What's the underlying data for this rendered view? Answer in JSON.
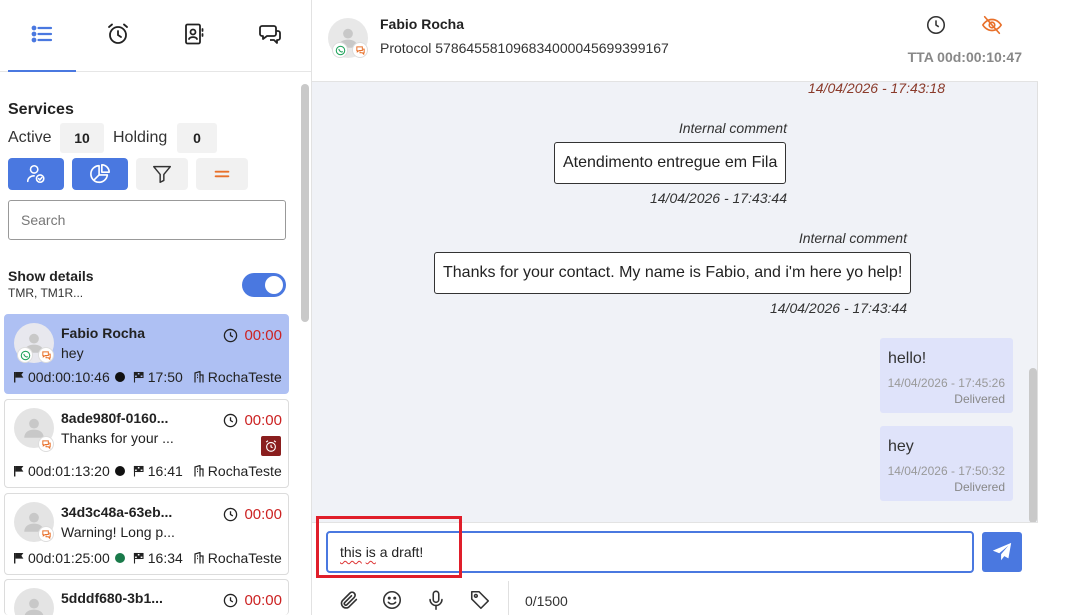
{
  "sidebar": {
    "tabs": [
      {
        "name": "list",
        "icon": "list-icon"
      },
      {
        "name": "alarm",
        "icon": "alarm-clock-icon"
      },
      {
        "name": "contacts",
        "icon": "contact-book-icon"
      },
      {
        "name": "chats",
        "icon": "chat-bubbles-icon"
      }
    ],
    "services_title": "Services",
    "active_label": "Active",
    "active_count": "10",
    "holding_label": "Holding",
    "holding_count": "0",
    "search_placeholder": "Search",
    "show_details_label": "Show details",
    "details_sub": "TMR, TM1R...",
    "show_details_on": true,
    "cards": [
      {
        "name": "Fabio Rocha",
        "message": "hey",
        "time": "00:00",
        "duration": "00d:00:10:46",
        "status_color": "#111111",
        "flag_time": "17:50",
        "team": "RochaTeste",
        "active": true
      },
      {
        "name": "8ade980f-0160...",
        "message": "Thanks for your ...",
        "time": "00:00",
        "duration": "00d:01:13:20",
        "status_color": "#111111",
        "flag_time": "16:41",
        "team": "RochaTeste",
        "active": false
      },
      {
        "name": "34d3c48a-63eb...",
        "message": "Warning! Long p...",
        "time": "00:00",
        "duration": "00d:01:25:00",
        "status_color": "#1a7a4a",
        "flag_time": "16:34",
        "team": "RochaTeste",
        "active": false
      },
      {
        "name": "5dddf680-3b1...",
        "time": "00:00"
      }
    ]
  },
  "header": {
    "name": "Fabio Rocha",
    "protocol": "Protocol 57864558109683400004569939916​7",
    "tta": "TTA 00d:00:10:47"
  },
  "messages": {
    "top_timestamp": "14/04/2026 - 17:43:18",
    "internal": [
      {
        "label": "Internal comment",
        "text": "Atendimento entregue em Fila",
        "timestamp": "14/04/2026 - 17:43:44"
      },
      {
        "label": "Internal comment",
        "text": "Thanks for your contact. My name is Fabio, and i'm here yo help!",
        "timestamp": "14/04/2026 - 17:43:44"
      }
    ],
    "outgoing": [
      {
        "text": "hello!",
        "timestamp": "14/04/2026 - 17:45:26",
        "status": "Delivered"
      },
      {
        "text": "hey",
        "timestamp": "14/04/2026 - 17:50:32",
        "status": "Delivered"
      }
    ]
  },
  "composer": {
    "draft_words": [
      "this",
      " ",
      "is",
      " a draft!"
    ],
    "char_count": "0/1500"
  },
  "colors": {
    "accent": "#4a78e0",
    "active_card": "#aec0f3",
    "timer_red": "#cc2222",
    "highlight": "#e01e2a"
  }
}
